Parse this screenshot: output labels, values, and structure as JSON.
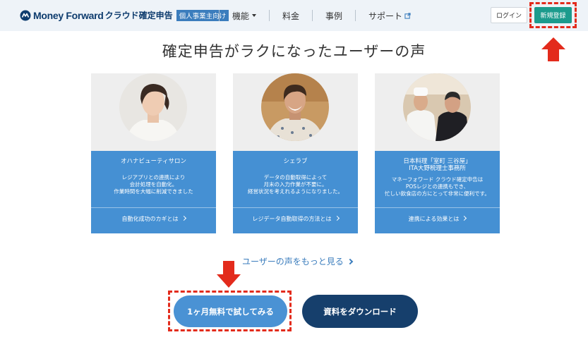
{
  "header": {
    "brand": "Money Forward",
    "product": "クラウド確定申告",
    "badge": "個人事業主向け",
    "nav": [
      {
        "label": "機能",
        "icon": "caret-down-icon"
      },
      {
        "label": "料金"
      },
      {
        "label": "事例"
      },
      {
        "label": "サポート",
        "icon": "external-link-icon"
      }
    ],
    "login_label": "ログイン",
    "signup_label": "新規登録"
  },
  "section": {
    "title": "確定申告がラクになったユーザーの声"
  },
  "cards": [
    {
      "name": "オハナビューティサロン",
      "desc": [
        "レジアプリとの連携により",
        "会計処理を自動化。",
        "作業時間を大幅に削減できました"
      ],
      "link": "自動化成功のカギとは"
    },
    {
      "name": "シェラブ",
      "desc": [
        "データの自動取得によって",
        "月末の入力作業が不要に。",
        "経営状況を考えれるようになりました。"
      ],
      "link": "レジデータ自動取得の方法とは"
    },
    {
      "name": [
        "日本料理「室町 三谷屋」",
        "ITA大野税理士事務所"
      ],
      "desc": [
        "マネーフォワード クラウド確定申告は",
        "POSレジとの連携もでき、",
        "忙しい飲食店の方にとって非常に便利です。"
      ],
      "link": "連携による効果とは"
    }
  ],
  "more_link": "ユーザーの声をもっと見る",
  "cta": {
    "trial": "1ヶ月無料で試してみる",
    "download": "資料をダウンロード"
  },
  "colors": {
    "header_bg": "#eef3f8",
    "brand_navy": "#0e3c6e",
    "signup_green": "#1c9b8d",
    "card_blue": "#4590d3",
    "cta_blue": "#4a92d4",
    "cta_navy": "#163f6c",
    "annotation_red": "#e32b1c"
  }
}
